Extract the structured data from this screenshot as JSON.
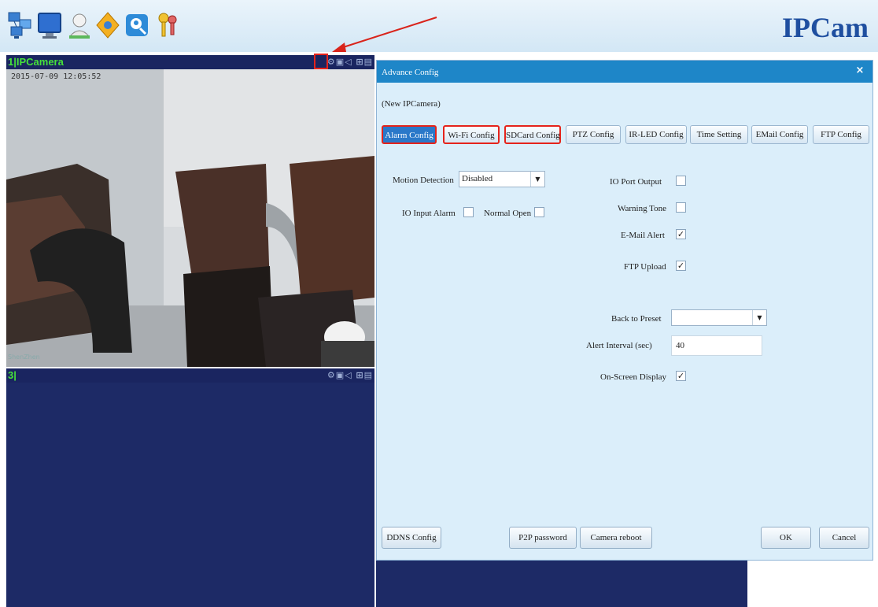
{
  "app": {
    "brand": "IPCam"
  },
  "toolbar_icons": [
    "network-icon",
    "monitor-icon",
    "user-icon",
    "settings-diamond-icon",
    "search-user-icon",
    "keys-icon"
  ],
  "panel1": {
    "title": "1|IPCamera",
    "timestamp": "2015-07-09 12:05:52",
    "tools": "⚙▣◁ ⊞▤",
    "video_label": "ShenZhen"
  },
  "panel2": {
    "title": "3|",
    "tools": "⚙▣◁ ⊞▤"
  },
  "dialog": {
    "title": "Advance Config",
    "close": "×",
    "camera_name": "(New IPCamera)",
    "tabs": [
      "Alarm Config",
      "Wi-Fi Config",
      "SDCard Config",
      "PTZ Config",
      "IR-LED Config",
      "Time Setting",
      "EMail Config",
      "FTP Config"
    ],
    "form": {
      "motion_detection_label": "Motion Detection",
      "motion_detection_value": "Disabled",
      "io_input_alarm_label": "IO Input Alarm",
      "normal_open_label": "Normal Open",
      "io_port_output_label": "IO Port Output",
      "warning_tone_label": "Warning Tone",
      "email_alert_label": "E-Mail Alert",
      "ftp_upload_label": "FTP Upload",
      "back_to_preset_label": "Back to Preset",
      "back_to_preset_value": "",
      "alert_interval_label": "Alert Interval (sec)",
      "alert_interval_value": "40",
      "osd_label": "On-Screen Display",
      "check_mark": "✓"
    },
    "buttons": {
      "ddns": "DDNS Config",
      "p2p": "P2P password",
      "reboot": "Camera reboot",
      "ok": "OK",
      "cancel": "Cancel"
    }
  },
  "colors": {
    "accent": "#1e86c8",
    "panel_bg": "#1d2a66",
    "highlight": "#e5231b",
    "title_green": "#46e13a"
  }
}
